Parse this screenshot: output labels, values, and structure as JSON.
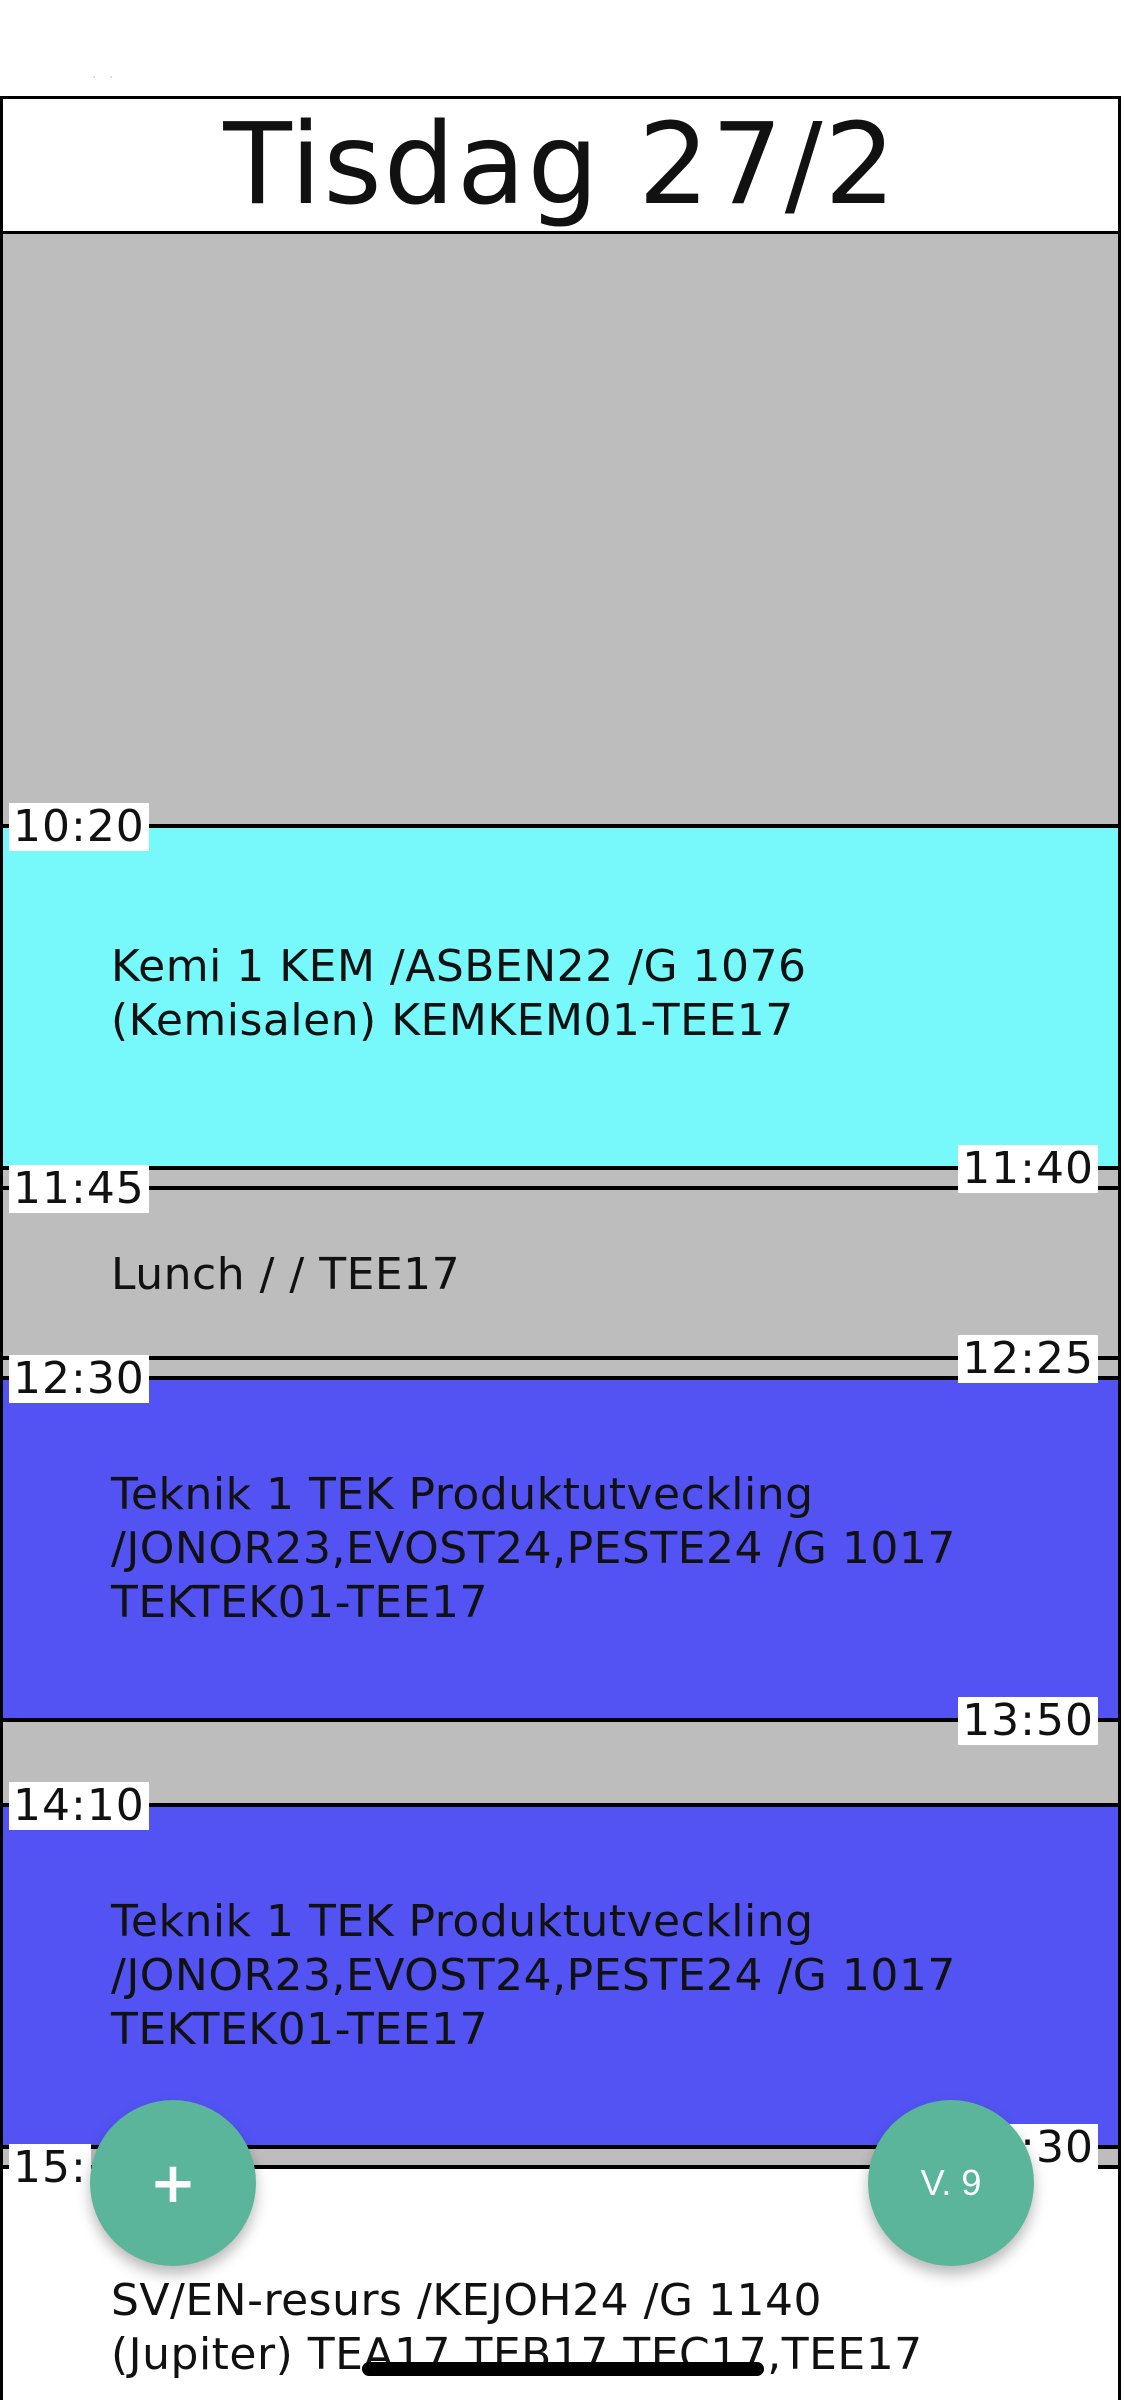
{
  "header": {
    "day_title": "Tisdag 27/2"
  },
  "events": [
    {
      "id": "kemi",
      "text": "Kemi 1 KEM  /ASBEN22  /G 1076 (Kemisalen) KEMKEM01-TEE17",
      "start": "10:20",
      "end": "11:40",
      "color": "#77f9fb"
    },
    {
      "id": "lunch",
      "text": "Lunch  /  / TEE17",
      "start": "11:45",
      "end": "12:25",
      "color": "#bdbdbd"
    },
    {
      "id": "teknik-1",
      "text": "Teknik 1 TEK Produktutveckling /JONOR23,EVOST24,PESTE24  /G 1017 TEKTEK01-TEE17",
      "start": "12:30",
      "end": "13:50",
      "color": "#5353f4"
    },
    {
      "id": "teknik-2",
      "text": "Teknik 1 TEK Produktutveckling /JONOR23,EVOST24,PESTE24  /G 1017 TEKTEK01-TEE17",
      "start": "14:10",
      "end": "15:30",
      "color": "#5353f4"
    },
    {
      "id": "sv-en",
      "text": "SV/EN-resurs  /KEJOH24  /G 1140 (Jupiter) TEA17,TEB17,TEC17,TEE17",
      "start": "15:",
      "end": "",
      "color": "#ffffff"
    }
  ],
  "fab": {
    "add_label": "+",
    "week_label": "V. 9"
  },
  "colors": {
    "free_time": "#bdbdbd",
    "accent_fab": "#5bb59a"
  }
}
